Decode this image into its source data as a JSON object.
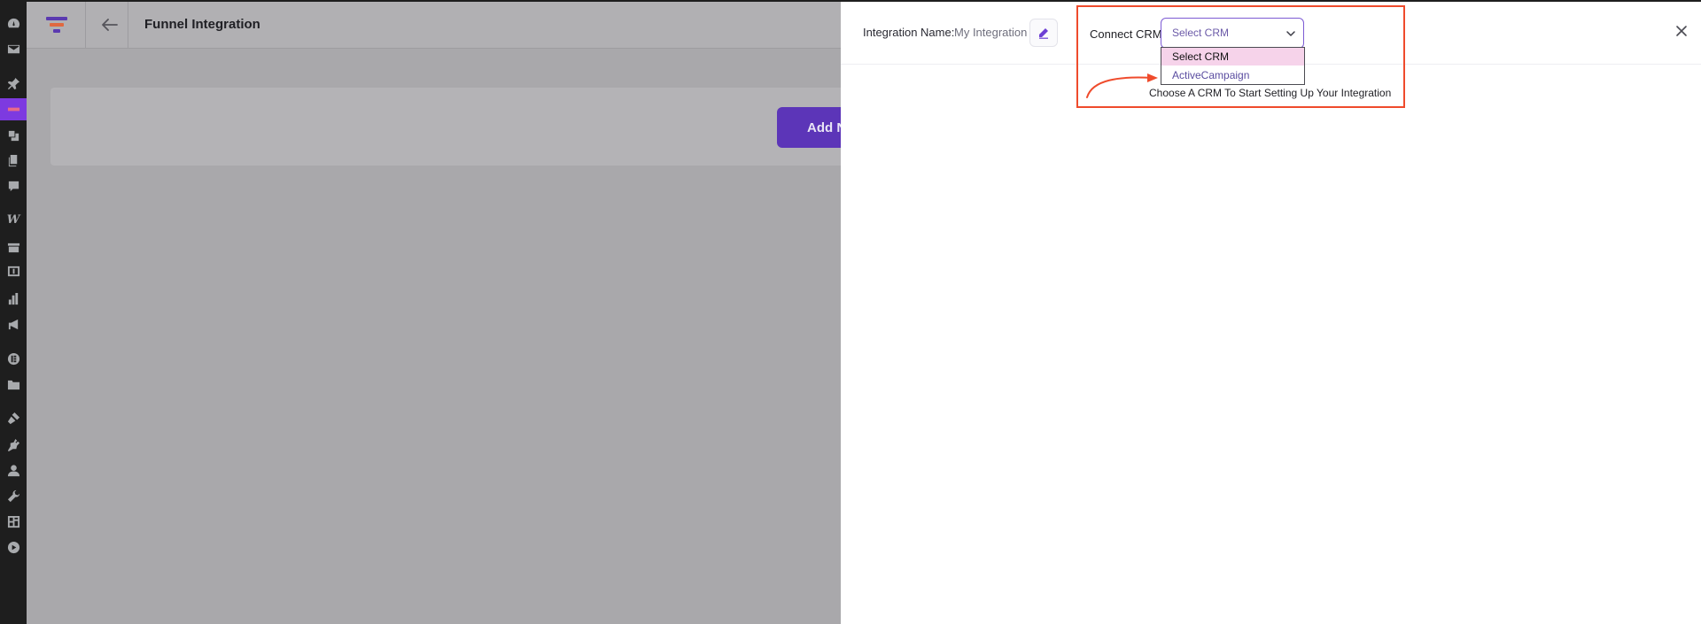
{
  "app": {
    "title": "Funnel Integration",
    "add_button_label": "Add N"
  },
  "drawer": {
    "integration_name_label": "Integration Name:",
    "integration_name_value": "My Integration",
    "connect_crm_label": "Connect CRM",
    "crm_select": {
      "selected": "Select CRM",
      "options": [
        "Select CRM",
        "ActiveCampaign"
      ]
    },
    "hint": "Choose A CRM To Start Setting Up Your Integration"
  },
  "colors": {
    "accent": "#5c35b8",
    "highlight_box": "#ef4b2c",
    "selected_option": "#f6d3ea"
  },
  "icons": {
    "sidebar": [
      "dashboard-icon",
      "mail-icon",
      "pin-icon",
      "funnel-menu-icon",
      "media-icon",
      "pages-icon",
      "comments-icon",
      "woo-icon",
      "products-icon",
      "payments-icon",
      "analytics-icon",
      "marketing-icon",
      "elementor-icon",
      "templates-icon",
      "appearance-icon",
      "plugins-icon",
      "users-icon",
      "tools-icon",
      "settings-icon",
      "play-icon"
    ]
  }
}
